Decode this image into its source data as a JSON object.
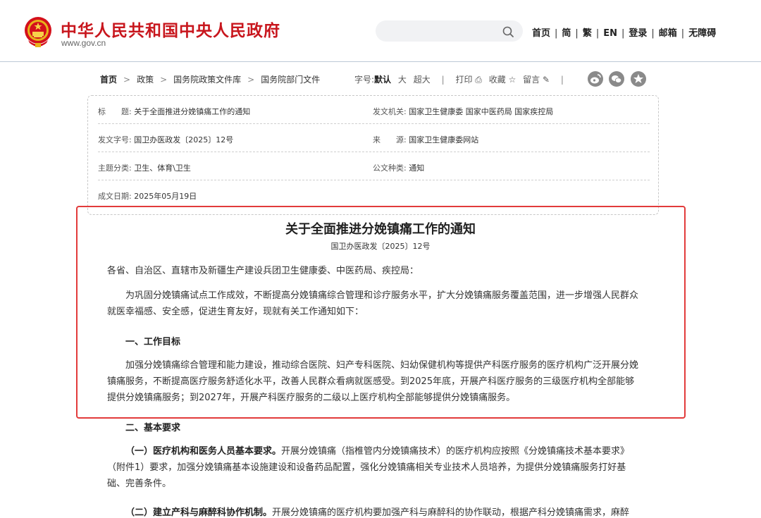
{
  "header": {
    "site_title": "中华人民共和国中央人民政府",
    "site_url": "www.gov.cn",
    "search_placeholder": "",
    "nav": [
      "首页",
      "简",
      "繁",
      "EN",
      "登录",
      "邮箱",
      "无障碍"
    ]
  },
  "breadcrumb": [
    "首页",
    "政策",
    "国务院政策文件库",
    "国务院部门文件"
  ],
  "tools": {
    "font_label": "字号:",
    "font_default": "默认",
    "font_large": "大",
    "font_xlarge": "超大",
    "print": "打印",
    "favorite": "收藏",
    "comment": "留言"
  },
  "info": {
    "title_label": "标　　题:",
    "title_value": "关于全面推进分娩镇痛工作的通知",
    "issuer_label": "发文机关:",
    "issuer_value": "国家卫生健康委  国家中医药局  国家疾控局",
    "docno_label": "发文字号:",
    "docno_value": "国卫办医政发〔2025〕12号",
    "source_label": "来　　源:",
    "source_value": "国家卫生健康委网站",
    "topic_label": "主题分类:",
    "topic_value": "卫生、体育\\卫生",
    "type_label": "公文种类:",
    "type_value": "通知",
    "date_label": "成文日期:",
    "date_value": "2025年05月19日"
  },
  "article": {
    "title": "关于全面推进分娩镇痛工作的通知",
    "docno": "国卫办医政发〔2025〕12号",
    "salutation": "各省、自治区、直辖市及新疆生产建设兵团卫生健康委、中医药局、疾控局：",
    "intro": "为巩固分娩镇痛试点工作成效，不断提高分娩镇痛综合管理和诊疗服务水平，扩大分娩镇痛服务覆盖范围，进一步增强人民群众就医幸福感、安全感，促进生育友好，现就有关工作通知如下：",
    "sec1_title": "一、工作目标",
    "sec1_body": "加强分娩镇痛综合管理和能力建设，推动综合医院、妇产专科医院、妇幼保健机构等提供产科医疗服务的医疗机构广泛开展分娩镇痛服务，不断提高医疗服务舒适化水平，改善人民群众看病就医感受。到2025年底，开展产科医疗服务的三级医疗机构全部能够提供分娩镇痛服务；到2027年，开展产科医疗服务的二级以上医疗机构全部能够提供分娩镇痛服务。",
    "sec2_title": "二、基本要求",
    "sub1_title": "（一）医疗机构和医务人员基本要求。",
    "sub1_body": "开展分娩镇痛（指椎管内分娩镇痛技术）的医疗机构应按照《分娩镇痛技术基本要求》（附件1）要求，加强分娩镇痛基本设施建设和设备药品配置，强化分娩镇痛相关专业技术人员培养，为提供分娩镇痛服务打好基础、完善条件。",
    "sub2_title": "（二）建立产科与麻醉科协作机制。",
    "sub2_body": "开展分娩镇痛的医疗机构要加强产科与麻醉科的协作联动，根据产科分娩镇痛需求，麻醉"
  }
}
